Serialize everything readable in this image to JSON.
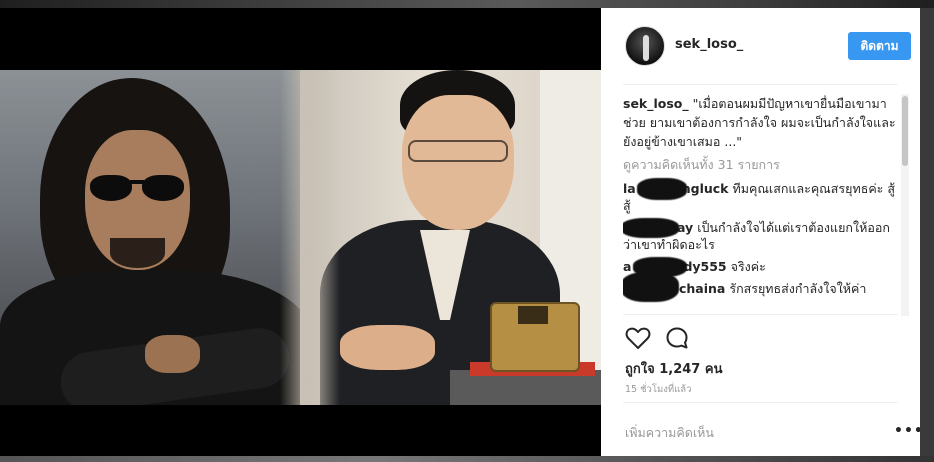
{
  "post": {
    "username": "sek_loso_",
    "follow_label": "ติดตาม",
    "caption_user": "sek_loso_",
    "caption_text": "\"เมื่อตอนผมมีปัญหาเขายื่นมือเขามาช่วย ยามเขาต้องการกำลังใจ ผมจะเป็นกำลังใจและยังอยู่ข้างเขาเสมอ ...\"",
    "view_all_comments": "ดูความคิดเห็นทั้ง 31 รายการ",
    "comments": [
      {
        "user": "la",
        "user_tail": "ngluck",
        "text": "ทีมคุณเสกและคุณสรยุทธค่ะ สู้ สู้"
      },
      {
        "user": "",
        "user_tail": "ay",
        "text": "เป็นกำลังใจได้แต่เราต้องแยกให้ออกว่าเขาทำผิดอะไร"
      },
      {
        "user": "a",
        "user_tail": "dy555",
        "text": "จริงค่ะ"
      },
      {
        "user": "",
        "user_tail": "chaina",
        "text": "รักสรยุทธส่งกำลังใจให้ค่า"
      }
    ],
    "likes": "ถูกใจ 1,247 คน",
    "time_ago": "15 ชั่วโมงที่แล้ว",
    "add_comment_placeholder": "เพิ่มความคิดเห็น",
    "more_label": "•••"
  },
  "icons": {
    "like": "heart-icon",
    "comment": "comment-icon",
    "more": "more-options-icon"
  },
  "colors": {
    "follow_button": "#3897f0",
    "secondary_text": "#999999",
    "primary_text": "#262626"
  }
}
